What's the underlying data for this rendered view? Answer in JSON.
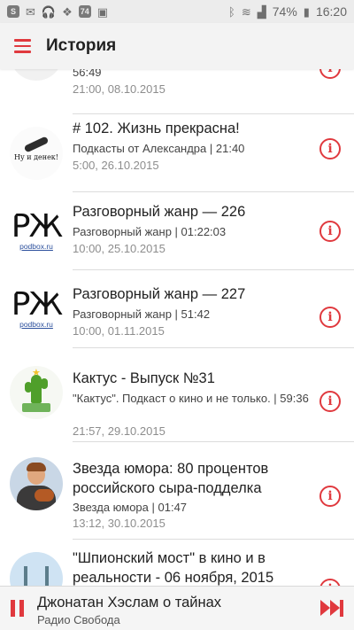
{
  "status_bar": {
    "left_icons": [
      "skype-icon",
      "mail-icon",
      "headphones-icon",
      "dropbox-icon",
      "app-74-icon",
      "picture-icon"
    ],
    "app_badge": "74",
    "battery": "74%",
    "time": "16:20"
  },
  "appbar": {
    "title": "История"
  },
  "history": [
    {
      "title": "",
      "subtitle": "56:49",
      "date": "21:00, 08.10.2015",
      "thumb": "partial-top"
    },
    {
      "title": "# 102. Жизнь прекрасна!",
      "subtitle": "Подкасты от Александра | 21:40",
      "date": "5:00, 26.10.2015",
      "thumb": "microphone",
      "thumb_text": "Ну и денек!"
    },
    {
      "title": "Разговорный жанр — 226",
      "subtitle": "Разговорный жанр | 01:22:03",
      "date": "10:00, 25.10.2015",
      "thumb": "rzh",
      "thumb_big": "РЖ",
      "thumb_small": "podbox.ru"
    },
    {
      "title": "Разговорный жанр — 227",
      "subtitle": "Разговорный жанр | 51:42",
      "date": "10:00, 01.11.2015",
      "thumb": "rzh",
      "thumb_big": "РЖ",
      "thumb_small": "podbox.ru"
    },
    {
      "title": "Кактус - Выпуск №31",
      "subtitle": "\"Кактус\". Подкаст о кино и не только. | 59:36",
      "date": "21:57, 29.10.2015",
      "thumb": "cactus"
    },
    {
      "title": "Звезда юмора: 80 процентов российского сыра-подделка",
      "subtitle": "Звезда юмора | 01:47",
      "date": "13:12, 30.10.2015",
      "thumb": "person"
    },
    {
      "title": "\"Шпионский мост\" в кино и в реальности - 06 ноября, 2015",
      "subtitle": "",
      "date": "",
      "thumb": "bridge"
    }
  ],
  "player": {
    "title": "Джонатан Хэслам о тайнах",
    "subtitle": "Радио Свобода"
  },
  "colors": {
    "accent": "#e0393e",
    "appbar_bg": "#f3f3f3",
    "statusbar_bg": "#ececec",
    "date_text": "#8d8d8d"
  }
}
